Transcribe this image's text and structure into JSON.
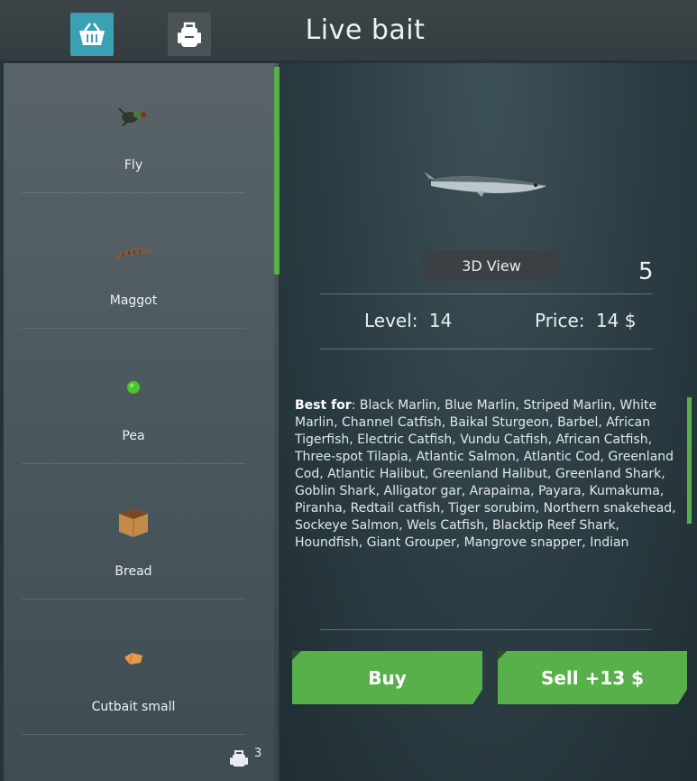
{
  "header": {
    "title": "Live bait",
    "tabs": [
      {
        "icon": "basket-icon",
        "active": true
      },
      {
        "icon": "backpack-icon",
        "active": false
      }
    ]
  },
  "items": [
    {
      "label": "Fly",
      "icon": "fly-icon"
    },
    {
      "label": "Maggot",
      "icon": "maggot-icon"
    },
    {
      "label": "Pea",
      "icon": "pea-icon"
    },
    {
      "label": "Bread",
      "icon": "bread-icon"
    },
    {
      "label": "Cutbait small",
      "icon": "cutbait-icon"
    }
  ],
  "inventory_count": "3",
  "details": {
    "view3d_label": "3D View",
    "quantity": "5",
    "level_label": "Level:",
    "level_value": "14",
    "price_label": "Price:",
    "price_value": "14 $",
    "bestfor_label": "Best for",
    "bestfor_text": ": Black Marlin, Blue Marlin, Striped Marlin, White Marlin, Channel Catfish, Baikal Sturgeon, Barbel, African Tigerfish, Electric Catfish, Vundu Catfish, African Catfish, Three-spot Tilapia, Atlantic Salmon, Atlantic Cod, Greenland Cod, Atlantic Halibut, Greenland Halibut, Greenland Shark, Goblin Shark, Alligator gar, Arapaima, Payara, Kumakuma, Piranha, Redtail catfish, Tiger sorubim, Northern snakehead, Sockeye Salmon, Wels Catfish, Blacktip Reef Shark, Houndfish, Giant Grouper, Mangrove snapper, Indian"
  },
  "actions": {
    "buy_label": "Buy",
    "sell_label": "Sell +13 $"
  },
  "colors": {
    "accent_green": "#58b04a",
    "tab_active": "#3aa0b4"
  }
}
